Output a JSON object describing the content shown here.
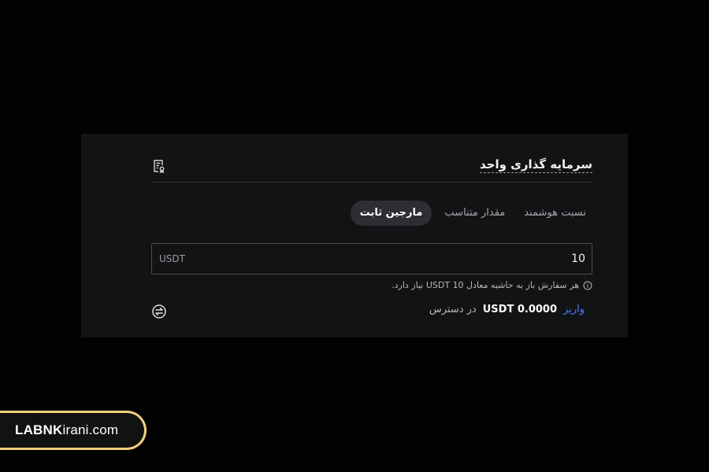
{
  "panel": {
    "title": "سرمایه گذاری واحد",
    "tabs": [
      {
        "label": "مارجین ثابت",
        "active": true
      },
      {
        "label": "مقدار متناسب",
        "active": false
      },
      {
        "label": "نسبت هوشمند",
        "active": false
      }
    ],
    "amount": {
      "value": "10",
      "unit": "USDT"
    },
    "hint": "هر سفارش باز به حاشیه معادل 10 USDT نیاز دارد.",
    "available": {
      "label": "در دسترس",
      "value": "USDT 0.0000",
      "deposit_label": "واریز"
    }
  },
  "icons": {
    "header": "calculator-document-icon",
    "info": "info-icon",
    "transfer": "transfer-icon"
  },
  "brand": {
    "strong": "LABNK",
    "rest": "irani.com",
    "border_color": "#f3cf7c"
  },
  "colors": {
    "link": "#4d7dff",
    "active_tab_bg": "#2c2e33",
    "panel_bg": "#121314"
  }
}
